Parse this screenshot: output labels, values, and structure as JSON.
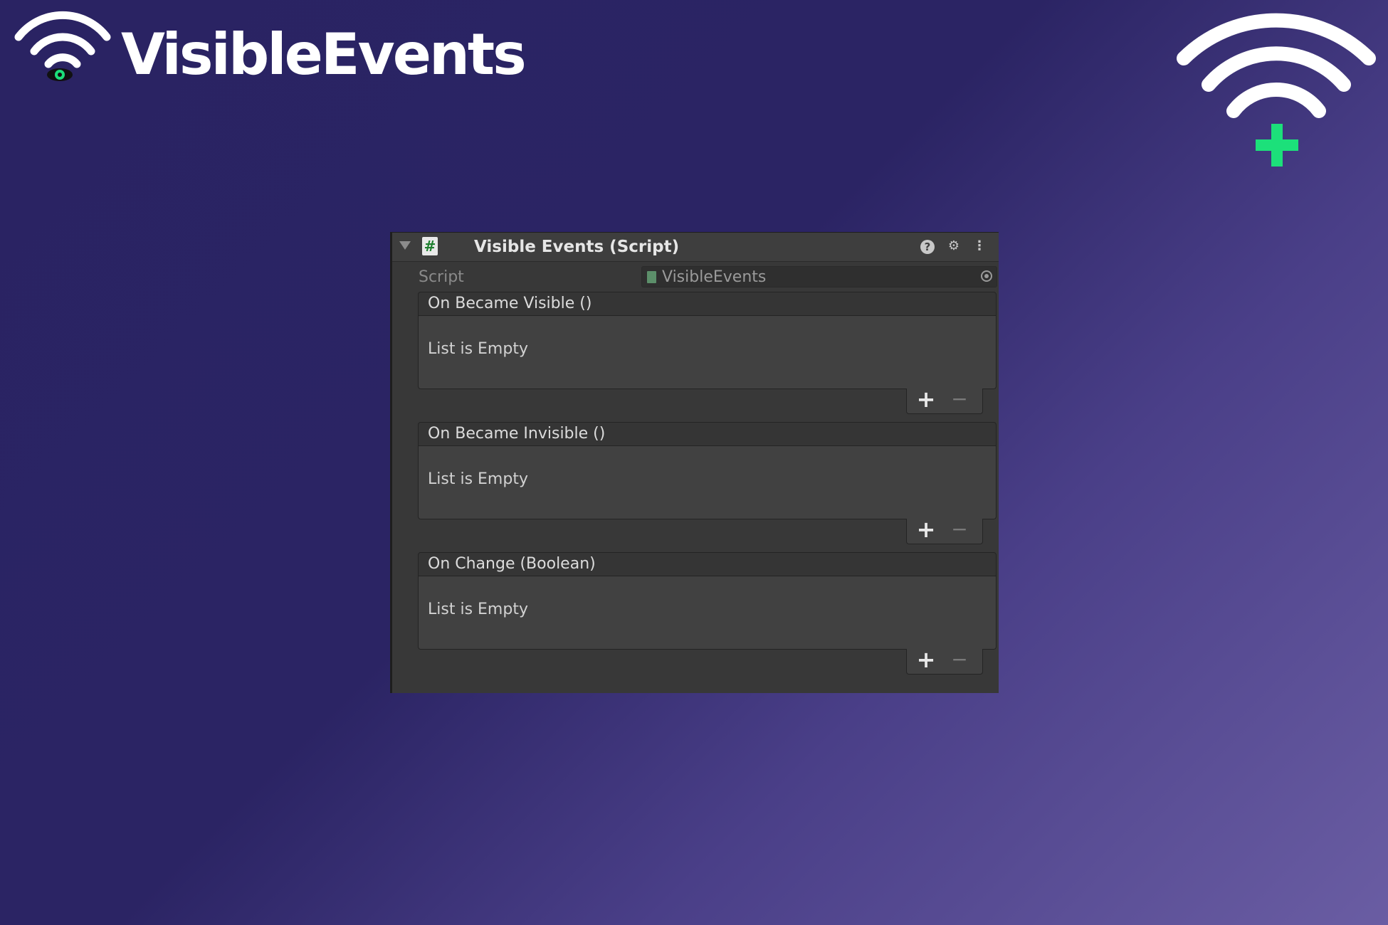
{
  "brand": {
    "title": "VisibleEvents",
    "logo_icon": "wifi-eye-icon",
    "corner_icon": "wifi-plus-icon",
    "accent_color": "#1ce07a"
  },
  "inspector": {
    "header": {
      "title": "Visible Events (Script)",
      "script_icon_glyph": "#",
      "help_glyph": "?",
      "presets_glyph": "⚙",
      "menu_glyph": "⋮"
    },
    "script": {
      "label": "Script",
      "value": "VisibleEvents"
    },
    "events": [
      {
        "title": "On Became Visible ()",
        "empty_text": "List is Empty",
        "add_label": "+",
        "remove_label": "−"
      },
      {
        "title": "On Became Invisible ()",
        "empty_text": "List is Empty",
        "add_label": "+",
        "remove_label": "−"
      },
      {
        "title": "On Change (Boolean)",
        "empty_text": "List is Empty",
        "add_label": "+",
        "remove_label": "−"
      }
    ]
  }
}
